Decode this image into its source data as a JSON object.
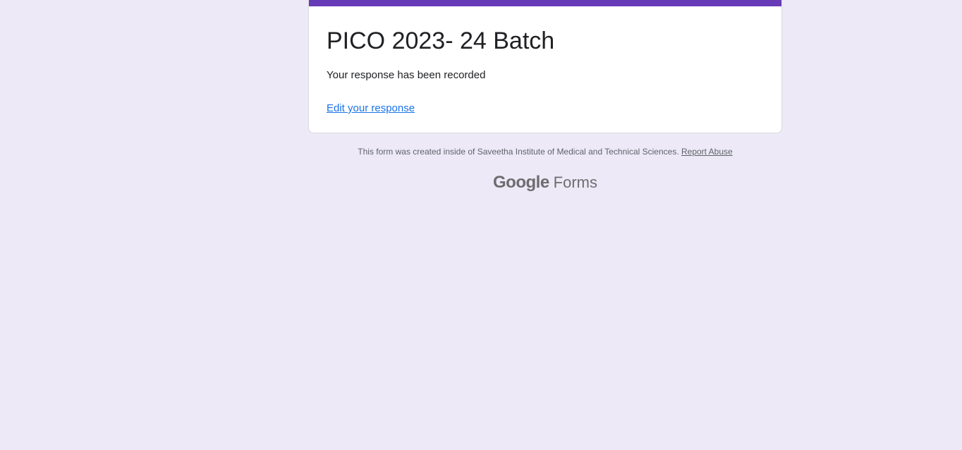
{
  "form": {
    "title": "PICO 2023- 24 Batch",
    "confirmation_message": "Your response has been recorded",
    "edit_link_label": "Edit your response",
    "accent_color": "#673ab7"
  },
  "footer": {
    "note": "This form was created inside of Saveetha Institute of Medical and Technical Sciences.",
    "report_link_label": "Report Abuse"
  },
  "branding": {
    "google_label": "Google",
    "product_label": "Forms"
  },
  "colors": {
    "background": "#ede9f7",
    "card": "#ffffff",
    "link": "#1a73e8"
  }
}
